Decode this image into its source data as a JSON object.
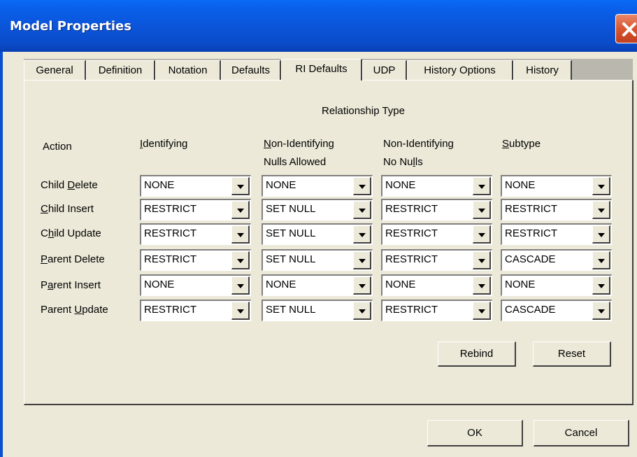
{
  "window": {
    "title": "Model Properties"
  },
  "tabs": [
    {
      "label": "General"
    },
    {
      "label": "Definition"
    },
    {
      "label": "Notation"
    },
    {
      "label": "Defaults"
    },
    {
      "label": "RI Defaults",
      "active": true
    },
    {
      "label": "UDP"
    },
    {
      "label": "History Options"
    },
    {
      "label": "History"
    }
  ],
  "ri": {
    "group_title": "Relationship Type",
    "action_header": "Action",
    "columns": {
      "identifying": {
        "key": "I",
        "rest": "dentifying"
      },
      "nonid_nulls": {
        "key": "N",
        "rest1": "on-Identifying",
        "line2": "Nulls Allowed"
      },
      "nonid_nonulls": {
        "line1": "Non-Identifying",
        "line2a": "No Nu",
        "key": "l",
        "line2b": "ls"
      },
      "subtype": {
        "key": "S",
        "rest": "ubtype"
      }
    },
    "rows": [
      {
        "pre": "Child ",
        "key": "D",
        "post": "elete",
        "values": [
          "NONE",
          "NONE",
          "NONE",
          "NONE"
        ]
      },
      {
        "pre": "",
        "key": "C",
        "post": "hild Insert",
        "values": [
          "RESTRICT",
          "SET NULL",
          "RESTRICT",
          "RESTRICT"
        ]
      },
      {
        "pre": "C",
        "key": "h",
        "post": "ild Update",
        "values": [
          "RESTRICT",
          "SET NULL",
          "RESTRICT",
          "RESTRICT"
        ]
      },
      {
        "pre": "",
        "key": "P",
        "post": "arent Delete",
        "values": [
          "RESTRICT",
          "SET NULL",
          "RESTRICT",
          "CASCADE"
        ]
      },
      {
        "pre": "P",
        "key": "a",
        "post": "rent Insert",
        "values": [
          "NONE",
          "NONE",
          "NONE",
          "NONE"
        ]
      },
      {
        "pre": "Parent ",
        "key": "U",
        "post": "pdate",
        "values": [
          "RESTRICT",
          "SET NULL",
          "RESTRICT",
          "CASCADE"
        ]
      }
    ],
    "rebind_label": "Rebind",
    "reset_label": "Reset"
  },
  "footer": {
    "ok_label": "OK",
    "cancel_label": "Cancel"
  },
  "icons": {
    "close": "close-icon",
    "dropdown": "chevron-down-icon"
  },
  "colors": {
    "titlebar": "#0a5ee8",
    "face": "#ece9d8",
    "close": "#d8562f"
  }
}
